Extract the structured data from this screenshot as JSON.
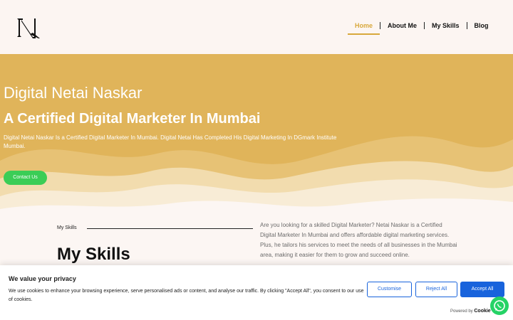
{
  "header": {
    "logo_icon": "nn-monogram-logo",
    "nav": [
      {
        "label": "Home",
        "active": true
      },
      {
        "label": "About Me",
        "active": false
      },
      {
        "label": "My Skills",
        "active": false
      },
      {
        "label": "Blog",
        "active": false
      }
    ],
    "accent_color": "#d8a83c"
  },
  "hero": {
    "title": "Digital Netai Naskar",
    "subtitle": "A Certified Digital Marketer In Mumbai",
    "description": "Digital Netai Naskar Is a Certified Digital Marketer In Mumbai. Digital Netai Has Completed His Digital Marketing In DGmark Institute Mumbai.",
    "cta_label": "Contact Us",
    "background_color": "#e0b45a",
    "cta_color": "#3bcd56"
  },
  "skills": {
    "label": "My Skills",
    "heading": "My Skills",
    "text": "Are you looking for a skilled Digital Marketer? Netai Naskar is a Certified Digital Marketer In Mumbai and offers affordable digital marketing services. Plus, he tailors his services to meet the needs of all businesses in the Mumbai area, making it easier for them to grow and succeed online."
  },
  "cookie_banner": {
    "title": "We value your privacy",
    "text": "We use cookies to enhance your browsing experience, serve personalised ads or content, and analyse our traffic. By clicking \"Accept All\", you consent to our use of cookies.",
    "customise_label": "Customise",
    "reject_label": "Reject All",
    "accept_label": "Accept All",
    "powered_by": "Powered by",
    "brand": "Cookie",
    "button_color": "#1863dc"
  },
  "floating": {
    "whatsapp_icon": "whatsapp-icon"
  }
}
